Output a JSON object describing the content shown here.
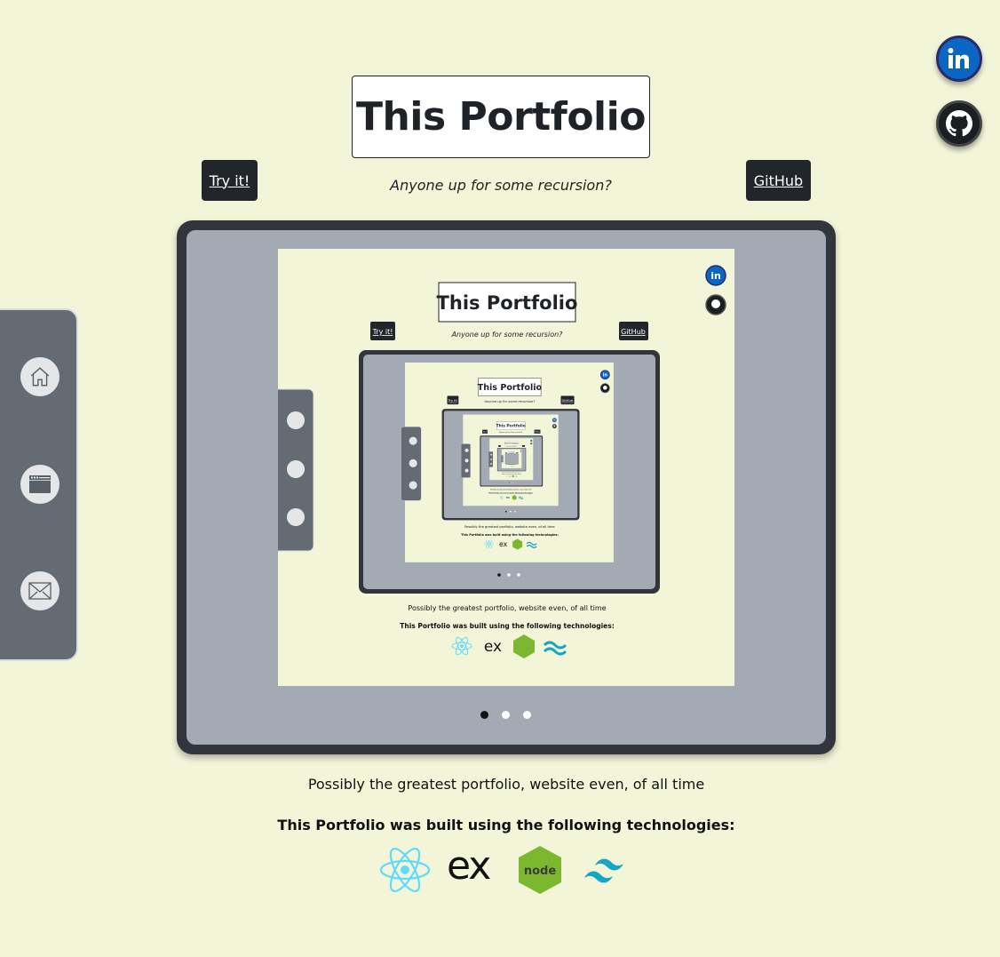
{
  "header": {
    "title": "This Portfolio",
    "subtitle": "Anyone up for some recursion?",
    "try_label": "Try it!",
    "github_label": "GitHub"
  },
  "social": [
    {
      "name": "linkedin",
      "icon": "linkedin-icon",
      "color": "#0a66c2"
    },
    {
      "name": "github",
      "icon": "github-icon",
      "color": "#1b1f23"
    }
  ],
  "sidebar": {
    "items": [
      {
        "icon": "home-icon"
      },
      {
        "icon": "browser-window-icon"
      },
      {
        "icon": "mail-icon"
      }
    ]
  },
  "carousel": {
    "slides": 3,
    "active": 0
  },
  "footer": {
    "tagline": "Possibly the greatest portfolio, website even, of all time",
    "built_with": "This Portfolio was built using the following technologies:",
    "technologies": [
      {
        "name": "react",
        "icon": "react-icon",
        "color": "#61dafb"
      },
      {
        "name": "express",
        "icon": "express-icon",
        "label": "ex"
      },
      {
        "name": "node",
        "icon": "node-icon",
        "label": "node",
        "color": "#7cb82f"
      },
      {
        "name": "tailwind",
        "icon": "tailwind-icon",
        "color": "#16a5c4"
      }
    ]
  },
  "colors": {
    "background": "#f3f5d9",
    "button": "#22262b",
    "sidebar": "#646b73",
    "device_frame": "#32363c",
    "device_inner": "#a3aab4"
  }
}
